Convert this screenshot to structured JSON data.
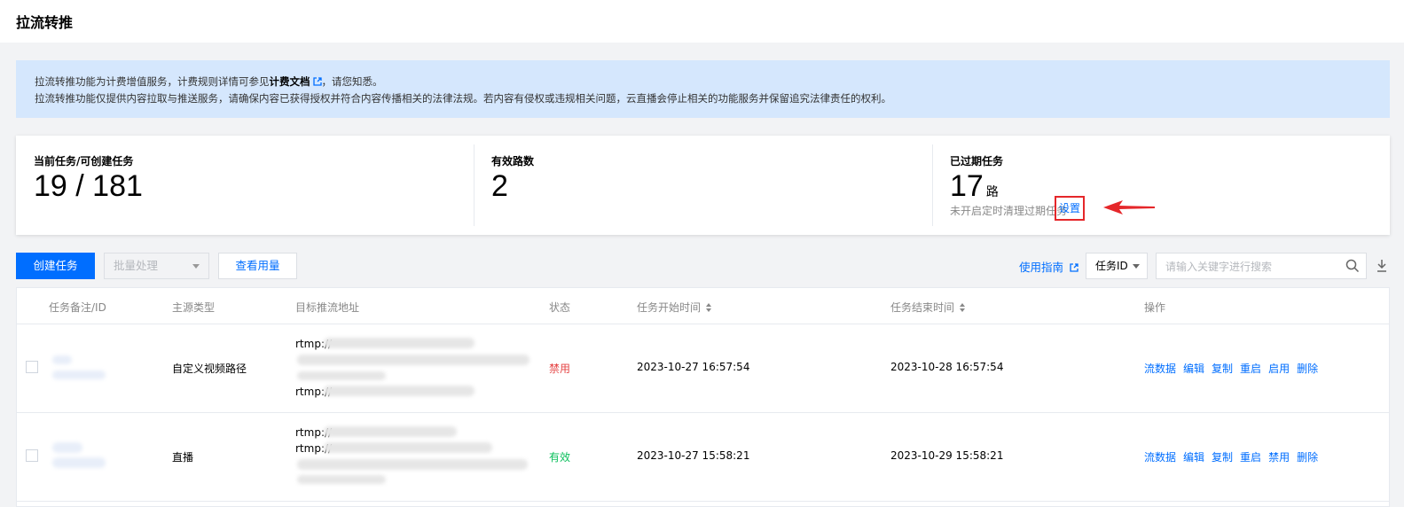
{
  "header": {
    "title": "拉流转推"
  },
  "notice": {
    "line1_prefix": "拉流转推功能为计费增值服务，计费规则详情可参见",
    "line1_link": "计费文档",
    "line1_suffix": "，请您知悉。",
    "line2": "拉流转推功能仅提供内容拉取与推送服务，请确保内容已获得授权并符合内容传播相关的法律法规。若内容有侵权或违规相关问题，云直播会停止相关的功能服务并保留追究法律责任的权利。"
  },
  "stats": {
    "current": {
      "label": "当前任务/可创建任务",
      "value": "19 / 181"
    },
    "valid": {
      "label": "有效路数",
      "value": "2"
    },
    "expired": {
      "label": "已过期任务",
      "value": "17",
      "unit": "路",
      "hint": "未开启定时清理过期任务",
      "settings_link": "设置"
    }
  },
  "toolbar": {
    "create_label": "创建任务",
    "batch_label": "批量处理",
    "usage_label": "查看用量",
    "guide_label": "使用指南",
    "filter_select": "任务ID",
    "search_placeholder": "请输入关键字进行搜索"
  },
  "table": {
    "columns": [
      "任务备注/ID",
      "主源类型",
      "目标推流地址",
      "状态",
      "任务开始时间",
      "任务结束时间",
      "操作"
    ],
    "rows": [
      {
        "source_type": "自定义视频路径",
        "urls": [
          "rtmp://",
          "rtmp://"
        ],
        "status": "禁用",
        "start": "2023-10-27 16:57:54",
        "end": "2023-10-28 16:57:54",
        "actions": [
          "流数据",
          "编辑",
          "复制",
          "重启",
          "启用",
          "删除"
        ]
      },
      {
        "source_type": "直播",
        "urls": [
          "rtmp://",
          "rtmp://"
        ],
        "status": "有效",
        "start": "2023-10-27 15:58:21",
        "end": "2023-10-29 15:58:21",
        "actions": [
          "流数据",
          "编辑",
          "复制",
          "重启",
          "禁用",
          "删除"
        ]
      }
    ]
  },
  "colors": {
    "primary": "#006eff",
    "notice_bg": "#d5e7fd",
    "status_disabled": "#e54545",
    "status_valid": "#0abf5b",
    "highlight": "#e5272a"
  }
}
